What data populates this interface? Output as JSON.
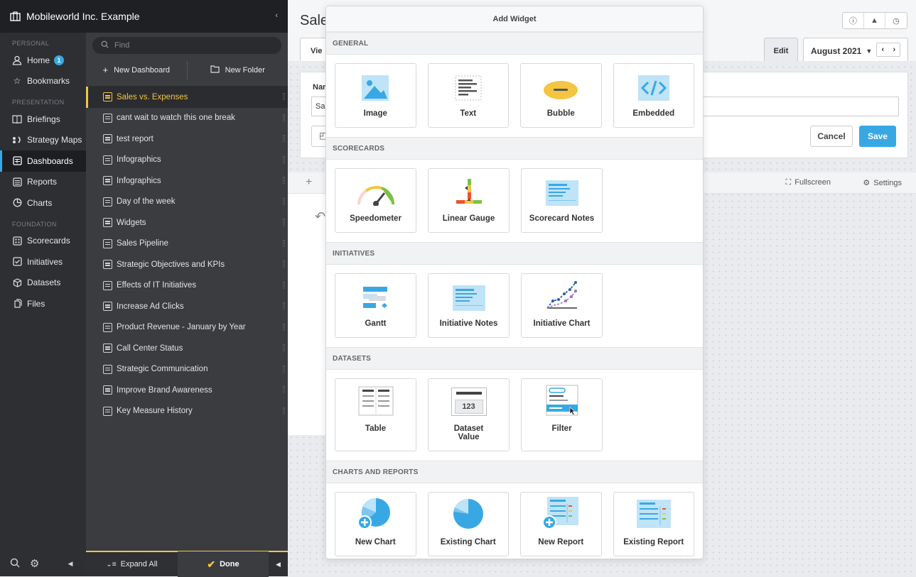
{
  "header": {
    "org_name": "Mobileworld Inc. Example",
    "collapse": "‹"
  },
  "nav": {
    "sections": {
      "personal": "PERSONAL",
      "presentation": "PRESENTATION",
      "foundation": "FOUNDATION"
    },
    "home": "Home",
    "home_badge": "1",
    "bookmarks": "Bookmarks",
    "briefings": "Briefings",
    "strategy_maps": "Strategy Maps",
    "dashboards": "Dashboards",
    "reports": "Reports",
    "charts": "Charts",
    "scorecards": "Scorecards",
    "initiatives": "Initiatives",
    "datasets": "Datasets",
    "files": "Files"
  },
  "panel": {
    "search_placeholder": "Find",
    "new_dashboard": "New Dashboard",
    "new_folder": "New Folder",
    "items": [
      "Sales vs. Expenses",
      "cant wait to watch this one break",
      "test report",
      "Infographics",
      "Infographics",
      "Day of the week",
      "Widgets",
      "Sales Pipeline",
      "Strategic Objectives and KPIs",
      "Effects of IT Initiatives",
      "Increase Ad Clicks",
      "Product Revenue - January by Year",
      "Call Center Status",
      "Strategic Communication",
      "Improve Brand Awareness",
      "Key Measure History"
    ],
    "expand_all": "Expand All",
    "done": "Done"
  },
  "main": {
    "title": "Sale",
    "view_tab": "Vie",
    "edit_tab": "Edit",
    "month": "August 2021",
    "name_label": "Nar",
    "name_value_partial": "Sa",
    "cancel": "Cancel",
    "save": "Save",
    "fullscreen": "Fullscreen",
    "settings": "Settings"
  },
  "modal": {
    "title": "Add Widget",
    "sections": [
      {
        "name": "GENERAL",
        "tiles": [
          "Image",
          "Text",
          "Bubble",
          "Embedded"
        ]
      },
      {
        "name": "SCORECARDS",
        "tiles": [
          "Speedometer",
          "Linear Gauge",
          "Scorecard Notes"
        ]
      },
      {
        "name": "INITIATIVES",
        "tiles": [
          "Gantt",
          "Initiative Notes",
          "Initiative Chart"
        ]
      },
      {
        "name": "DATASETS",
        "tiles": [
          "Table",
          "Dataset Value",
          "Filter"
        ],
        "dataset_value_sample": "123"
      },
      {
        "name": "CHARTS AND REPORTS",
        "tiles": [
          "New Chart",
          "Existing Chart",
          "New Report",
          "Existing Report"
        ]
      }
    ]
  },
  "colors": {
    "accent": "#38a8e4",
    "active_dashboard": "#f4c542",
    "nav_bg": "#2d2f33"
  }
}
